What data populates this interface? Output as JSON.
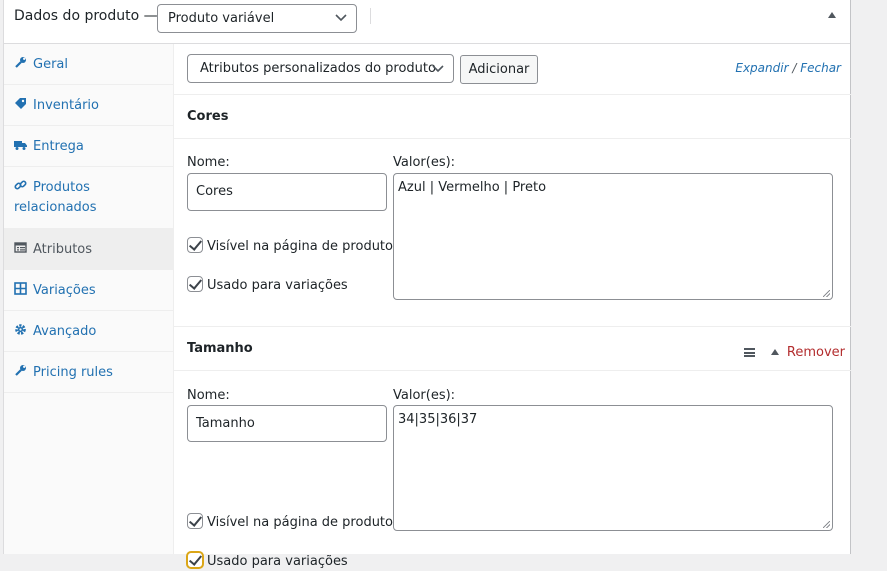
{
  "header": {
    "title": "Dados do produto —",
    "product_type": "Produto variável"
  },
  "sidebar": {
    "items": [
      {
        "label": "Geral",
        "icon": "wrench-icon"
      },
      {
        "label": "Inventário",
        "icon": "tag-icon"
      },
      {
        "label": "Entrega",
        "icon": "truck-icon"
      },
      {
        "label": "Produtos relacionados",
        "icon": "link-icon"
      },
      {
        "label": "Atributos",
        "icon": "list-icon",
        "active": true
      },
      {
        "label": "Variações",
        "icon": "grid-icon"
      },
      {
        "label": "Avançado",
        "icon": "gear-icon"
      },
      {
        "label": "Pricing rules",
        "icon": "wrench-icon"
      }
    ]
  },
  "toolbar": {
    "attribute_select": "Atributos personalizados do produto",
    "add_label": "Adicionar",
    "expand_label": "Expandir",
    "separator": "/",
    "close_label": "Fechar"
  },
  "attributes": [
    {
      "title": "Cores",
      "name_label": "Nome:",
      "name_value": "Cores",
      "values_label": "Valor(es):",
      "values": "Azul | Vermelho | Preto",
      "visible_label": "Visível na página de produto",
      "variation_label": "Usado para variações"
    },
    {
      "title": "Tamanho",
      "remove_label": "Remover",
      "name_label": "Nome:",
      "name_value": "Tamanho",
      "values_label": "Valor(es):",
      "values": "34|35|36|37",
      "visible_label": "Visível na página de produto",
      "variation_label": "Usado para variações"
    }
  ]
}
